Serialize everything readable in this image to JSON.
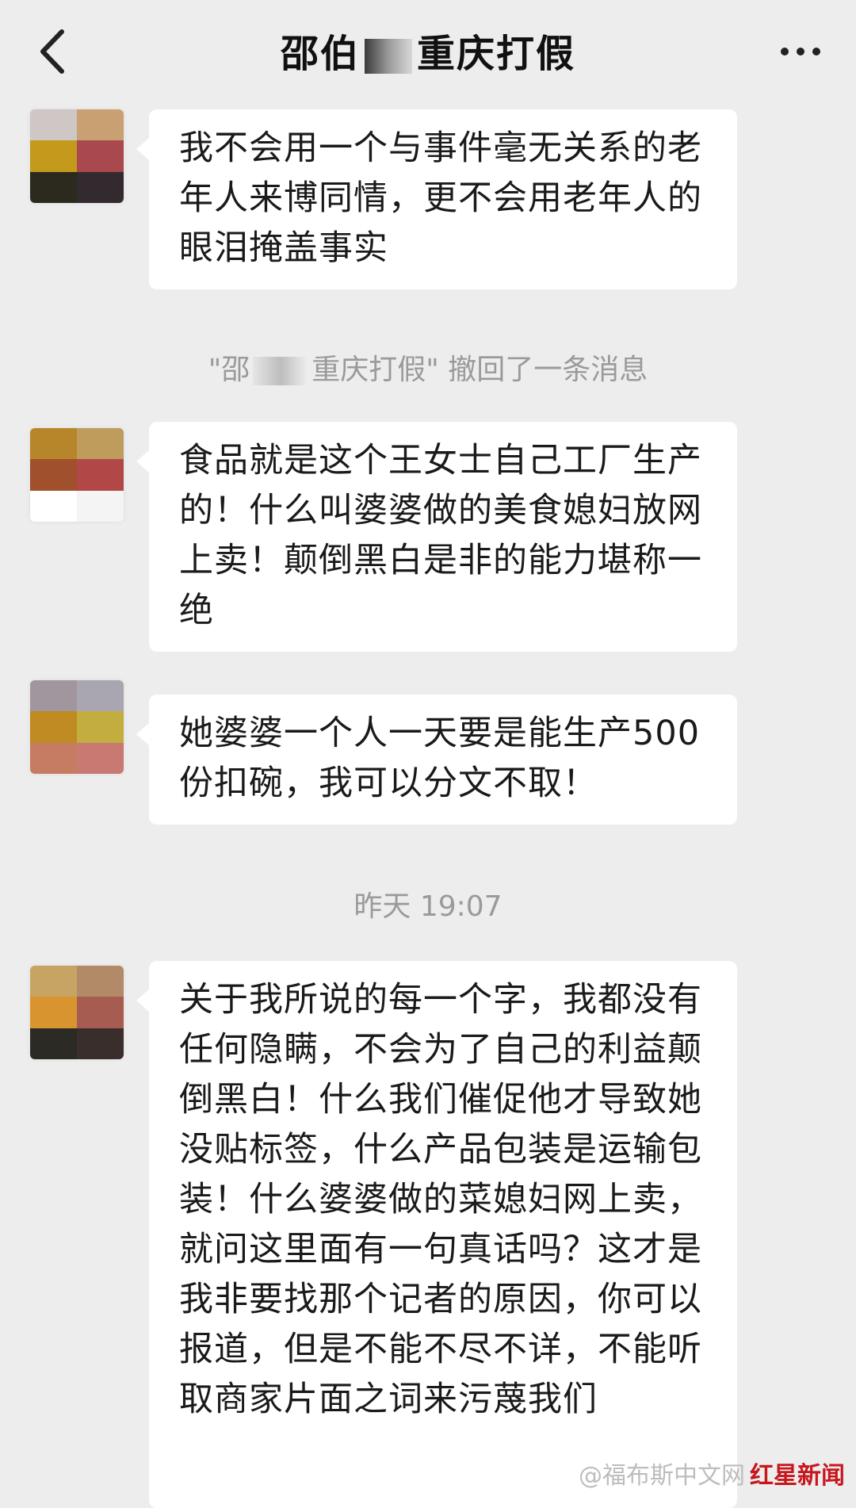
{
  "header": {
    "title_prefix": "邵伯",
    "title_suffix": "重庆打假",
    "back_icon": "chevron-left-icon",
    "more_icon": "more-dots-icon"
  },
  "messages": [
    {
      "text": "我不会用一个与事件毫无关系的老年人来博同情，更不会用老年人的眼泪掩盖事实"
    },
    {
      "text": "食品就是这个王女士自己工厂生产的！什么叫婆婆做的美食媳妇放网上卖！颠倒黑白是非的能力堪称一绝"
    },
    {
      "text": "她婆婆一个人一天要是能生产500份扣碗，我可以分文不取！"
    },
    {
      "text": "关于我所说的每一个字，我都没有任何隐瞒，不会为了自己的利益颠倒黑白！什么我们催促他才导致她没贴标签，什么产品包装是运输包装！什么婆婆做的菜媳妇网上卖，就问这里面有一句真话吗？这才是我非要找那个记者的原因，你可以报道，但是不能不尽不详，不能听取商家片面之词来污蔑我们"
    }
  ],
  "recall_notice": {
    "prefix": "\"邵",
    "suffix": "重庆打假\" 撤回了一条消息"
  },
  "timestamp": "昨天 19:07",
  "watermark": {
    "text": "@福布斯中文网",
    "brand": "红星新闻"
  },
  "colors": {
    "background": "#ededed",
    "bubble": "#ffffff",
    "text": "#1a1a1a",
    "system_text": "#9a9a9a"
  }
}
